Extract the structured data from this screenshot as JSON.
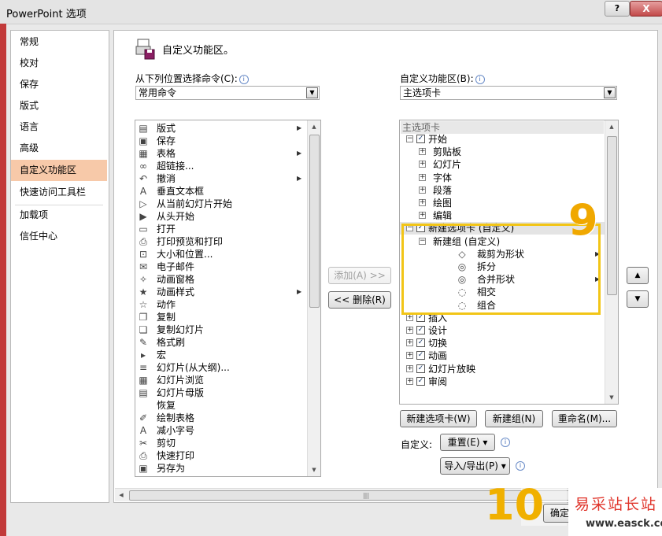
{
  "window": {
    "title": "PowerPoint 选项",
    "help": "?",
    "close": "X"
  },
  "nav": {
    "items": [
      {
        "label": "常规",
        "selected": false
      },
      {
        "label": "校对",
        "selected": false
      },
      {
        "label": "保存",
        "selected": false
      },
      {
        "label": "版式",
        "selected": false
      },
      {
        "label": "语言",
        "selected": false
      },
      {
        "label": "高级",
        "selected": false
      },
      {
        "label": "自定义功能区",
        "selected": true
      },
      {
        "label": "快速访问工具栏",
        "selected": false
      },
      {
        "label": "加载项",
        "selected": false
      },
      {
        "label": "信任中心",
        "selected": false
      }
    ]
  },
  "header": {
    "title": "自定义功能区。"
  },
  "left": {
    "choose_label": "从下列位置选择命令(C):",
    "choose_value": "常用命令",
    "commands": [
      {
        "label": "版式",
        "icon": "layout-icon",
        "submenu": true
      },
      {
        "label": "保存",
        "icon": "save-icon",
        "submenu": false
      },
      {
        "label": "表格",
        "icon": "table-icon",
        "submenu": true
      },
      {
        "label": "超链接...",
        "icon": "hyperlink-icon",
        "submenu": false
      },
      {
        "label": "撤消",
        "icon": "undo-icon",
        "submenu": true
      },
      {
        "label": "垂直文本框",
        "icon": "vertical-textbox-icon",
        "submenu": false
      },
      {
        "label": "从当前幻灯片开始",
        "icon": "play-from-current-icon",
        "submenu": false
      },
      {
        "label": "从头开始",
        "icon": "play-from-start-icon",
        "submenu": false
      },
      {
        "label": "打开",
        "icon": "open-folder-icon",
        "submenu": false
      },
      {
        "label": "打印预览和打印",
        "icon": "print-preview-icon",
        "submenu": false
      },
      {
        "label": "大小和位置...",
        "icon": "size-position-icon",
        "submenu": false
      },
      {
        "label": "电子邮件",
        "icon": "email-icon",
        "submenu": false
      },
      {
        "label": "动画窗格",
        "icon": "animation-pane-icon",
        "submenu": false
      },
      {
        "label": "动画样式",
        "icon": "animation-style-icon",
        "submenu": true
      },
      {
        "label": "动作",
        "icon": "action-icon",
        "submenu": false
      },
      {
        "label": "复制",
        "icon": "copy-icon",
        "submenu": false
      },
      {
        "label": "复制幻灯片",
        "icon": "duplicate-slide-icon",
        "submenu": false
      },
      {
        "label": "格式刷",
        "icon": "format-painter-icon",
        "submenu": false
      },
      {
        "label": "宏",
        "icon": "macro-icon",
        "submenu": false
      },
      {
        "label": "幻灯片(从大纲)...",
        "icon": "slides-from-outline-icon",
        "submenu": false
      },
      {
        "label": "幻灯片浏览",
        "icon": "slide-sorter-icon",
        "submenu": false
      },
      {
        "label": "幻灯片母版",
        "icon": "slide-master-icon",
        "submenu": false
      },
      {
        "label": "恢复",
        "icon": "blank-icon",
        "submenu": false
      },
      {
        "label": "绘制表格",
        "icon": "draw-table-icon",
        "submenu": false
      },
      {
        "label": "减小字号",
        "icon": "decrease-font-icon",
        "submenu": false
      },
      {
        "label": "剪切",
        "icon": "scissors-icon",
        "submenu": false
      },
      {
        "label": "快速打印",
        "icon": "quick-print-icon",
        "submenu": false
      },
      {
        "label": "另存为",
        "icon": "save-as-icon",
        "submenu": false
      }
    ]
  },
  "middle": {
    "add_label": "添加(A) >>",
    "remove_label": "<< 删除(R)"
  },
  "right": {
    "customize_label": "自定义功能区(B):",
    "customize_value": "主选项卡",
    "group_header": "主选项卡",
    "tree": [
      {
        "level": 0,
        "expander": "⊟",
        "checked": true,
        "label": "开始",
        "highlight": false
      },
      {
        "level": 1,
        "expander": "⊞",
        "checked": null,
        "label": "剪贴板"
      },
      {
        "level": 1,
        "expander": "⊞",
        "checked": null,
        "label": "幻灯片"
      },
      {
        "level": 1,
        "expander": "⊞",
        "checked": null,
        "label": "字体"
      },
      {
        "level": 1,
        "expander": "⊞",
        "checked": null,
        "label": "段落"
      },
      {
        "level": 1,
        "expander": "⊞",
        "checked": null,
        "label": "绘图"
      },
      {
        "level": 1,
        "expander": "⊞",
        "checked": null,
        "label": "编辑"
      },
      {
        "level": 0,
        "expander": "⊟",
        "checked": true,
        "label": "新建选项卡 (自定义)",
        "highlight": true
      },
      {
        "level": 1,
        "expander": "⊟",
        "checked": null,
        "label": "新建组 (自定义)"
      },
      {
        "level": 2,
        "expander": "",
        "checked": null,
        "label": "裁剪为形状",
        "icon": "crop-shape-icon",
        "submenu": true
      },
      {
        "level": 2,
        "expander": "",
        "checked": null,
        "label": "拆分",
        "icon": "fragment-icon"
      },
      {
        "level": 2,
        "expander": "",
        "checked": null,
        "label": "合并形状",
        "icon": "merge-shapes-icon",
        "submenu": true
      },
      {
        "level": 2,
        "expander": "",
        "checked": null,
        "label": "相交",
        "icon": "intersect-icon"
      },
      {
        "level": 2,
        "expander": "",
        "checked": null,
        "label": "组合",
        "icon": "combine-icon"
      },
      {
        "level": 0,
        "expander": "⊞",
        "checked": true,
        "label": "插入"
      },
      {
        "level": 0,
        "expander": "⊞",
        "checked": true,
        "label": "设计"
      },
      {
        "level": 0,
        "expander": "⊞",
        "checked": true,
        "label": "切换"
      },
      {
        "level": 0,
        "expander": "⊞",
        "checked": true,
        "label": "动画"
      },
      {
        "level": 0,
        "expander": "⊞",
        "checked": true,
        "label": "幻灯片放映"
      },
      {
        "level": 0,
        "expander": "⊞",
        "checked": true,
        "label": "审阅"
      }
    ],
    "new_tab_label": "新建选项卡(W)",
    "new_group_label": "新建组(N)",
    "rename_label": "重命名(M)...",
    "customizations_label": "自定义:",
    "reset_label": "重置(E) ▾",
    "import_export_label": "导入/导出(P) ▾",
    "move_up": "▲",
    "move_down": "▼"
  },
  "annotations": {
    "step9": "9",
    "step10": "10"
  },
  "ok_label": "确定",
  "watermark": {
    "title": "易采站长站",
    "url": "www.easck.com"
  },
  "colors": {
    "nav_selected": "#f7c9a9",
    "highlight_box": "#f2c517",
    "annotation": "#f0a800",
    "watermark_red": "#e0342a"
  }
}
